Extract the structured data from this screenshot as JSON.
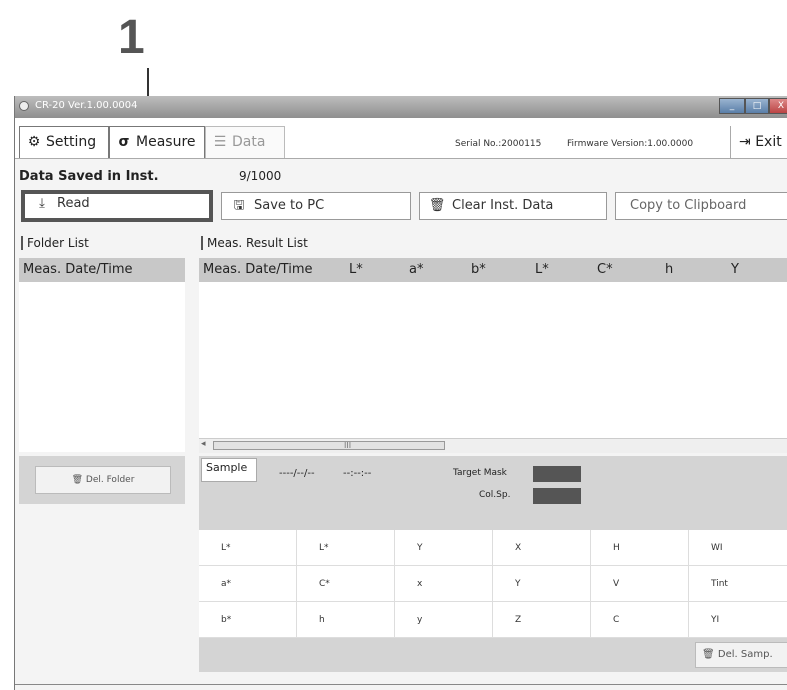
{
  "callout": {
    "number": "1"
  },
  "window": {
    "title": "CR-20 Ver.1.00.0004",
    "controls": {
      "minimize": "_",
      "maximize": "□",
      "close": "X"
    }
  },
  "tabs": [
    {
      "label": "Setting",
      "icon": "gear-icon",
      "glyph": "⚙"
    },
    {
      "label": "Measure",
      "icon": "measure-icon",
      "glyph": "σ"
    },
    {
      "label": "Data",
      "icon": "list-icon",
      "glyph": "☰"
    }
  ],
  "header": {
    "serial": "Serial No.:2000115",
    "firmware": "Firmware Version:1.00.0000",
    "exit_label": "Exit",
    "exit_glyph": "⇥"
  },
  "saved": {
    "label": "Data Saved in Inst.",
    "value": "9/1000"
  },
  "toolbar": {
    "read_label": "Read",
    "read_glyph": "⤓",
    "save_label": "Save to PC",
    "save_glyph": "🖫",
    "clear_label": "Clear Inst. Data",
    "clear_glyph": "🗑",
    "copy_label": "Copy to Clipboard"
  },
  "folder_list": {
    "header": "Folder List",
    "column": "Meas. Date/Time",
    "delete_label": "Del. Folder",
    "delete_glyph": "🗑"
  },
  "result_list": {
    "header": "Meas. Result List",
    "columns": [
      "Meas. Date/Time",
      "L*",
      "a*",
      "b*",
      "L*",
      "C*",
      "h",
      "Y"
    ],
    "scroll_grip": "III",
    "scroll_arrow": "◂"
  },
  "sample": {
    "tab_label": "Sample",
    "date": "----/--/--",
    "time": "--:--:--",
    "target_label": "Target Mask",
    "colsp_label": "Col.Sp."
  },
  "grid": [
    [
      "L*",
      "L*",
      "Y",
      "X",
      "H",
      "WI"
    ],
    [
      "a*",
      "C*",
      "x",
      "Y",
      "V",
      "Tint"
    ],
    [
      "b*",
      "h",
      "y",
      "Z",
      "C",
      "YI"
    ]
  ],
  "del_sample": {
    "label": "Del. Samp.",
    "glyph": "🗑"
  }
}
